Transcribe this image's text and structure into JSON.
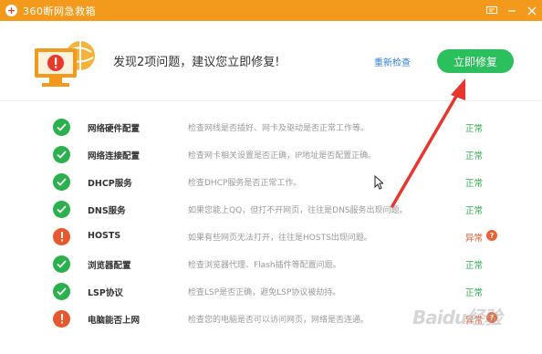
{
  "window": {
    "title": "360断网急救箱",
    "icons": {
      "app": "red-cross-icon",
      "feedback": "chat-icon",
      "minimize": "minimize-icon",
      "close": "close-icon"
    }
  },
  "header": {
    "message": "发现2项问题，建议您立即修复!",
    "recheck_label": "重新检查",
    "fix_button_label": "立即修复"
  },
  "items": [
    {
      "name": "网络硬件配置",
      "description": "检查网线是否插好、网卡及驱动是否正常工作等。",
      "status": "正常",
      "state": "ok"
    },
    {
      "name": "网络连接配置",
      "description": "检查网卡相关设置是否正确，IP地址是否配置正确。",
      "status": "正常",
      "state": "ok"
    },
    {
      "name": "DHCP服务",
      "description": "检查DHCP服务是否正常工作。",
      "status": "正常",
      "state": "ok"
    },
    {
      "name": "DNS服务",
      "description": "如果您能上QQ，但打不开网页，往往是DNS服务出现问题。",
      "status": "正常",
      "state": "ok"
    },
    {
      "name": "HOSTS",
      "description": "如果有些网页无法打开，往往是HOSTS出现问题。",
      "status": "异常",
      "state": "error"
    },
    {
      "name": "浏览器配置",
      "description": "检查浏览器代理、Flash插件等配置问题。",
      "status": "正常",
      "state": "ok"
    },
    {
      "name": "LSP协议",
      "description": "检查LSP是否正确，避免LSP协议被劫持。",
      "status": "正常",
      "state": "ok"
    },
    {
      "name": "电脑能否上网",
      "description": "检查您的电脑是否可以访问网页，网络是否连通。",
      "status": "异常",
      "state": "error"
    }
  ],
  "colors": {
    "titlebar": "#f39a1c",
    "ok": "#2bb04e",
    "error": "#e8572e",
    "fix_button": "#2bbf5e",
    "annotation_arrow": "#e8362e"
  },
  "watermark": "Baidu经验"
}
